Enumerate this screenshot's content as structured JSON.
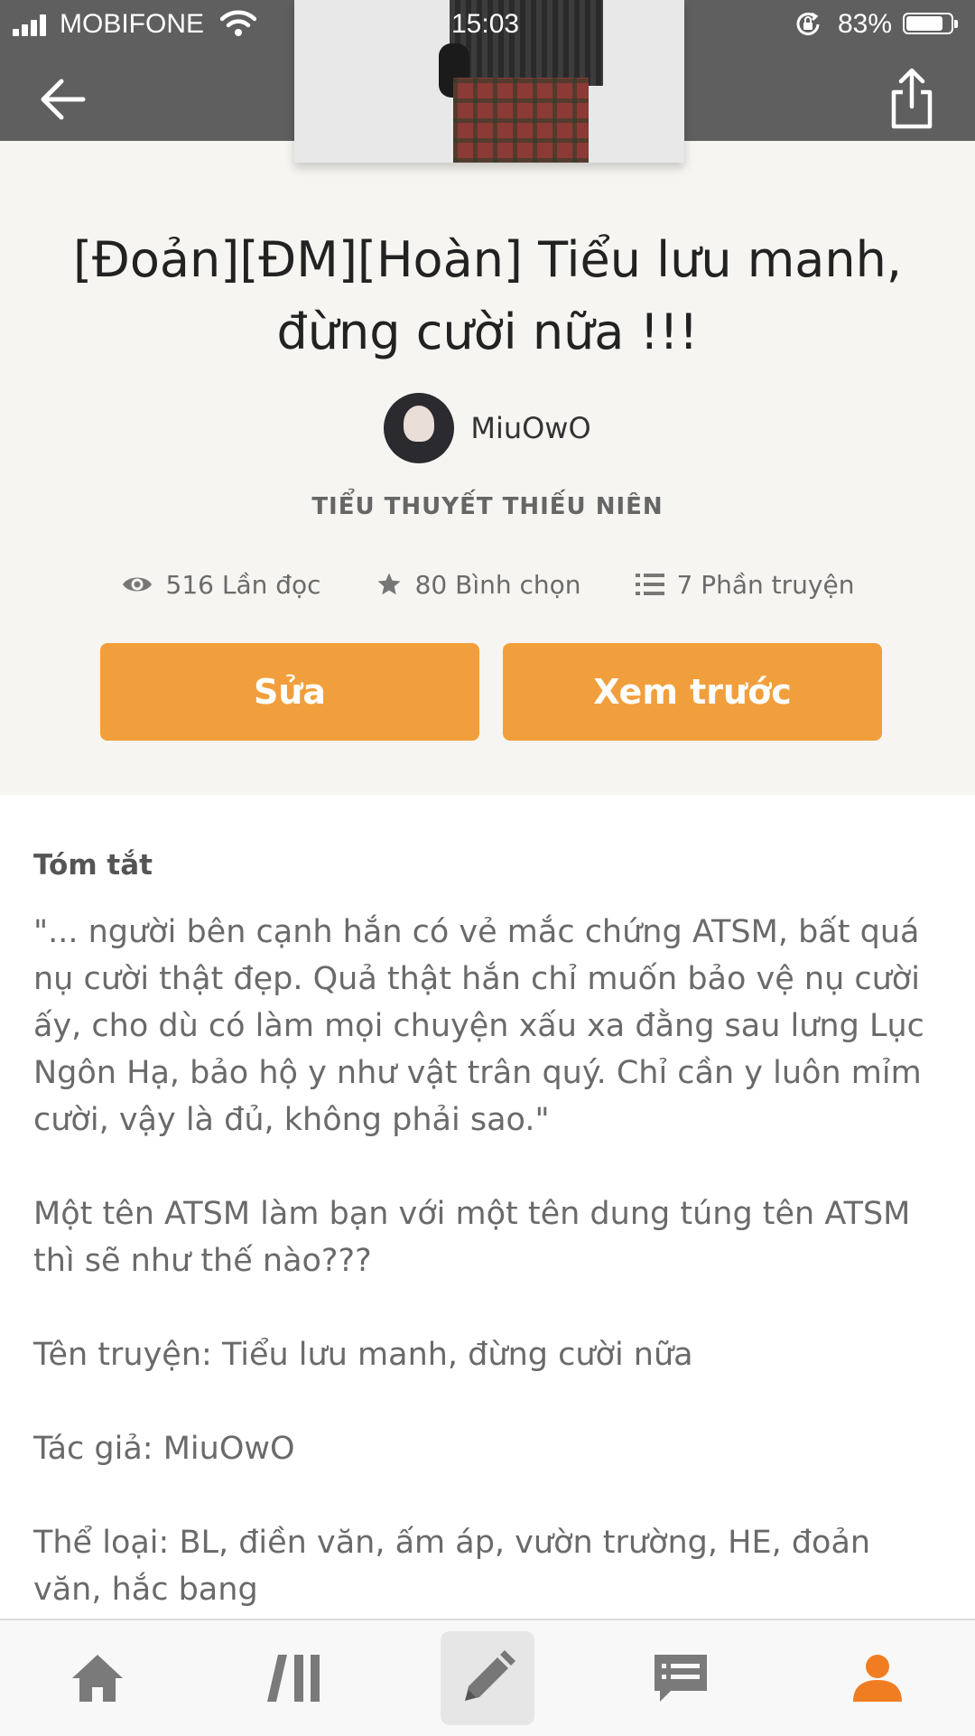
{
  "status_bar": {
    "carrier": "MOBIFONE",
    "time": "15:03",
    "battery_percent": "83%",
    "battery_level": 0.83
  },
  "header": {
    "back_icon": "arrow-left-icon",
    "share_icon": "share-icon"
  },
  "story": {
    "title_line1": "[Đoản][ĐM][Hoàn] Tiểu lưu manh,",
    "title_line2": "đừng cười nữa !!!",
    "author": "MiuOwO",
    "category": "TIỂU THUYẾT THIẾU NIÊN",
    "stats": {
      "reads": "516 Lần đọc",
      "votes": "80 Bình chọn",
      "parts": "7 Phần truyện"
    }
  },
  "actions": {
    "edit_label": "Sửa",
    "preview_label": "Xem trước"
  },
  "summary": {
    "heading": "Tóm tắt",
    "paragraphs": [
      "\"... người bên cạnh hắn có vẻ mắc chứng ATSM, bất quá nụ cười thật đẹp. Quả thật hắn chỉ muốn bảo vệ nụ cười ấy, cho dù có làm mọi chuyện xấu xa đằng sau lưng Lục Ngôn Hạ, bảo hộ y như vật trân quý. Chỉ cần y luôn mỉm cười, vậy là đủ, không phải sao.\"",
      "Một tên ATSM làm bạn với một tên dung túng tên ATSM thì sẽ như thế nào???",
      "Tên truyện: Tiểu lưu manh, đừng cười nữa",
      "Tác giả: MiuOwO",
      "Thể loại: BL, điền văn, ấm áp, vườn trường, HE, đoản văn, hắc bang"
    ]
  },
  "tab_bar": {
    "items": [
      {
        "icon": "home-icon"
      },
      {
        "icon": "library-icon"
      },
      {
        "icon": "pencil-icon",
        "active": true
      },
      {
        "icon": "messages-icon"
      },
      {
        "icon": "profile-icon"
      }
    ]
  },
  "colors": {
    "accent": "#f19f3c",
    "profile_active": "#f07d22",
    "header_gray": "#5f5f5f",
    "hero_bg": "#f6f5f1"
  }
}
